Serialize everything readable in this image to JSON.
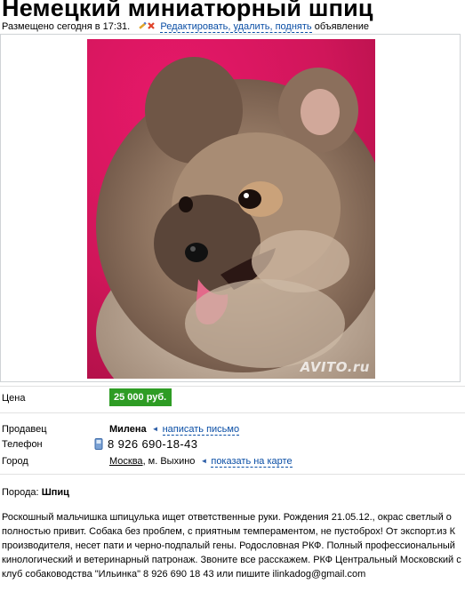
{
  "listing": {
    "title": "Немецкий миниатюрный шпиц",
    "posted": "Размещено сегодня в 17:31.",
    "edit_link": "Редактировать, удалить, поднять",
    "edit_suffix": "объявление"
  },
  "photo": {
    "watermark": "AVITO.ru",
    "alt": "Pomeranian puppy on pink background"
  },
  "price": {
    "label": "Цена",
    "value": "25 000 руб."
  },
  "seller": {
    "label": "Продавец",
    "name": "Милена",
    "message_link": "написать письмо"
  },
  "phone": {
    "label": "Телефон",
    "number": "8 926 690-18-43"
  },
  "city": {
    "label": "Город",
    "city": "Москва",
    "district": ", м. Выхино",
    "map_link": "показать на карте"
  },
  "breed": {
    "label": "Порода:",
    "value": "Шпиц"
  },
  "description": [
    "Роскошный мальчишка шпицулька ищет ответственные руки. Рождения 21.05.12., окрас светлый о",
    "полностью привит. Собака без проблем, с приятным темпераментом, не пустоброх! От экспорт.из К",
    "производителя, несет пати и черно-подпалый гены. Родословная РКФ. Полный профессиональный",
    "кинологический и ветеринарный патронаж. Звоните все расскажем. РКФ Центральный Московский с",
    "клуб собаководства \"Ильинка\" 8 926 690 18 43 или пишите ilinkadog@gmail.com"
  ],
  "colors": {
    "price_badge": "#2e9c24",
    "link": "#0a4ea5",
    "photo_bg": "#d81a5e"
  }
}
